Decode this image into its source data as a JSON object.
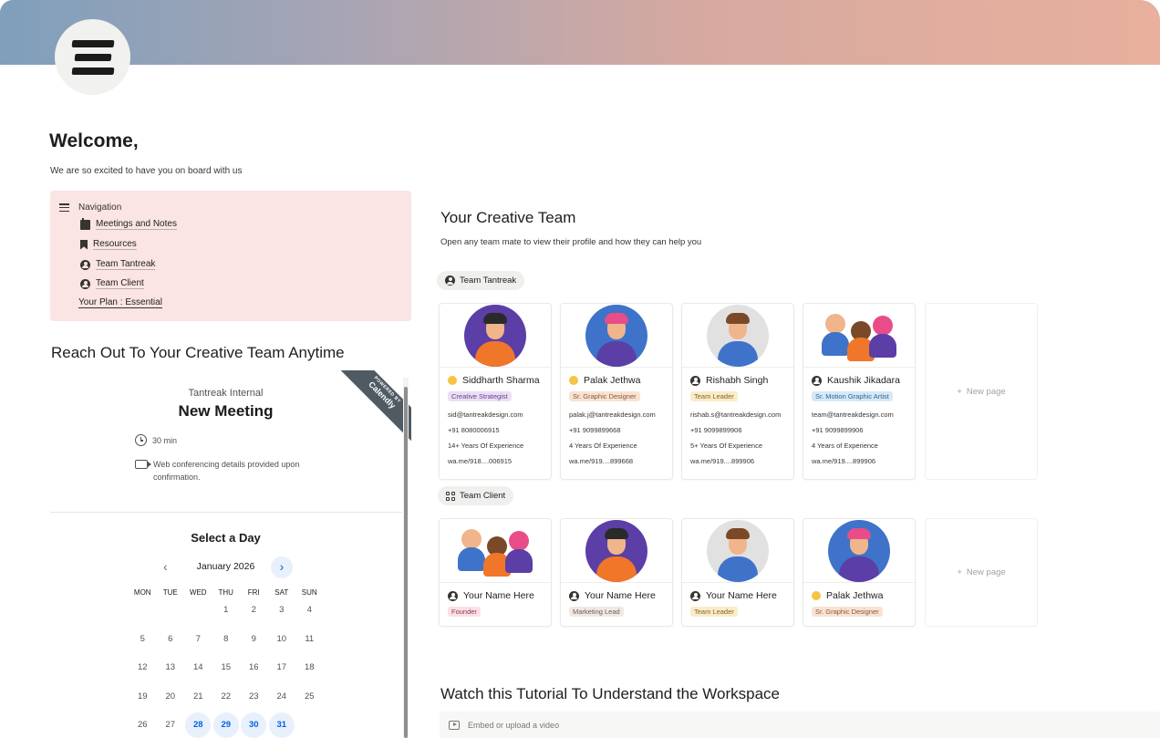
{
  "header": {
    "welcome": "Welcome,",
    "subtitle": "We are so excited to have you on board with us"
  },
  "navigation": {
    "heading": "Navigation",
    "items": [
      {
        "label": "Meetings and Notes",
        "icon": "calendar-icon"
      },
      {
        "label": "Resources",
        "icon": "bookmark-icon"
      },
      {
        "label": "Team Tantreak",
        "icon": "user-circle-icon"
      },
      {
        "label": "Team Client",
        "icon": "user-circle-icon"
      }
    ],
    "plan": "Your Plan : Essential"
  },
  "reach_out": {
    "heading": "Reach Out To Your Creative Team Anytime"
  },
  "calendly": {
    "ribbon_small": "POWERED BY",
    "ribbon_brand": "Calendly",
    "organization": "Tantreak Internal",
    "event": "New Meeting",
    "duration": "30 min",
    "conferencing": "Web conferencing details provided upon confirmation.",
    "select_title": "Select a Day",
    "month": "January 2026",
    "dows": [
      "MON",
      "TUE",
      "WED",
      "THU",
      "FRI",
      "SAT",
      "SUN"
    ],
    "weeks": [
      [
        "",
        "",
        "",
        "1",
        "2",
        "3",
        "4"
      ],
      [
        "5",
        "6",
        "7",
        "8",
        "9",
        "10",
        "11"
      ],
      [
        "12",
        "13",
        "14",
        "15",
        "16",
        "17",
        "18"
      ],
      [
        "19",
        "20",
        "21",
        "22",
        "23",
        "24",
        "25"
      ],
      [
        "26",
        "27",
        "28",
        "29",
        "30",
        "31",
        ""
      ]
    ],
    "available_days": [
      "28",
      "29",
      "30",
      "31"
    ]
  },
  "team": {
    "title": "Your Creative Team",
    "subtitle": "Open any team mate to view their profile and how they can help you",
    "group_tantreak": "Team Tantreak",
    "group_client": "Team Client",
    "new_page": "New page",
    "tantreak_members": [
      {
        "name": "Siddharth Sharma",
        "role": "Creative Strategist",
        "role_bg": "#eadff5",
        "role_fg": "#6b3f8e",
        "email": "sid@tantreakdesign.com",
        "phone": "+91 8080006915",
        "experience": "14+ Years Of Experience",
        "wa": "wa.me/918....006915"
      },
      {
        "name": "Palak Jethwa",
        "role": "Sr. Graphic Designer",
        "role_bg": "#f8e3d4",
        "role_fg": "#8d5634",
        "email": "palak.j@tantreakdesign.com",
        "phone": "+91 9099899668",
        "experience": "4 Years Of Experience",
        "wa": "wa.me/919....899668"
      },
      {
        "name": "Rishabh Singh",
        "role": "Team Leader",
        "role_bg": "#f9ecc9",
        "role_fg": "#8a6320",
        "email": "rishab.s@tantreakdesign.com",
        "phone": "+91 9099899906",
        "experience": "5+ Years Of Experience",
        "wa": "wa.me/919....899906"
      },
      {
        "name": "Kaushik Jikadara",
        "role": "Sr. Motion Graphic Artist",
        "role_bg": "#d7e8f6",
        "role_fg": "#2c6592",
        "email": "team@tantreakdesign.com",
        "phone": "+91 9099899906",
        "experience": "4 Years of Experience",
        "wa": "wa.me/919....899906"
      }
    ],
    "client_members": [
      {
        "name": "Your Name Here",
        "role": "Founder",
        "role_bg": "#fbe0e6",
        "role_fg": "#8d3b55"
      },
      {
        "name": "Your Name Here",
        "role": "Marketing Lead",
        "role_bg": "#efe9e5",
        "role_fg": "#6f5a4d"
      },
      {
        "name": "Your Name Here",
        "role": "Team Leader",
        "role_bg": "#f9ecc9",
        "role_fg": "#8a6320"
      },
      {
        "name": "Palak Jethwa",
        "role": "Sr. Graphic Designer",
        "role_bg": "#f8e3d4",
        "role_fg": "#8d5634"
      }
    ]
  },
  "tutorial": {
    "heading": "Watch this Tutorial To Understand the Workspace",
    "embed": "Embed or upload a video"
  }
}
